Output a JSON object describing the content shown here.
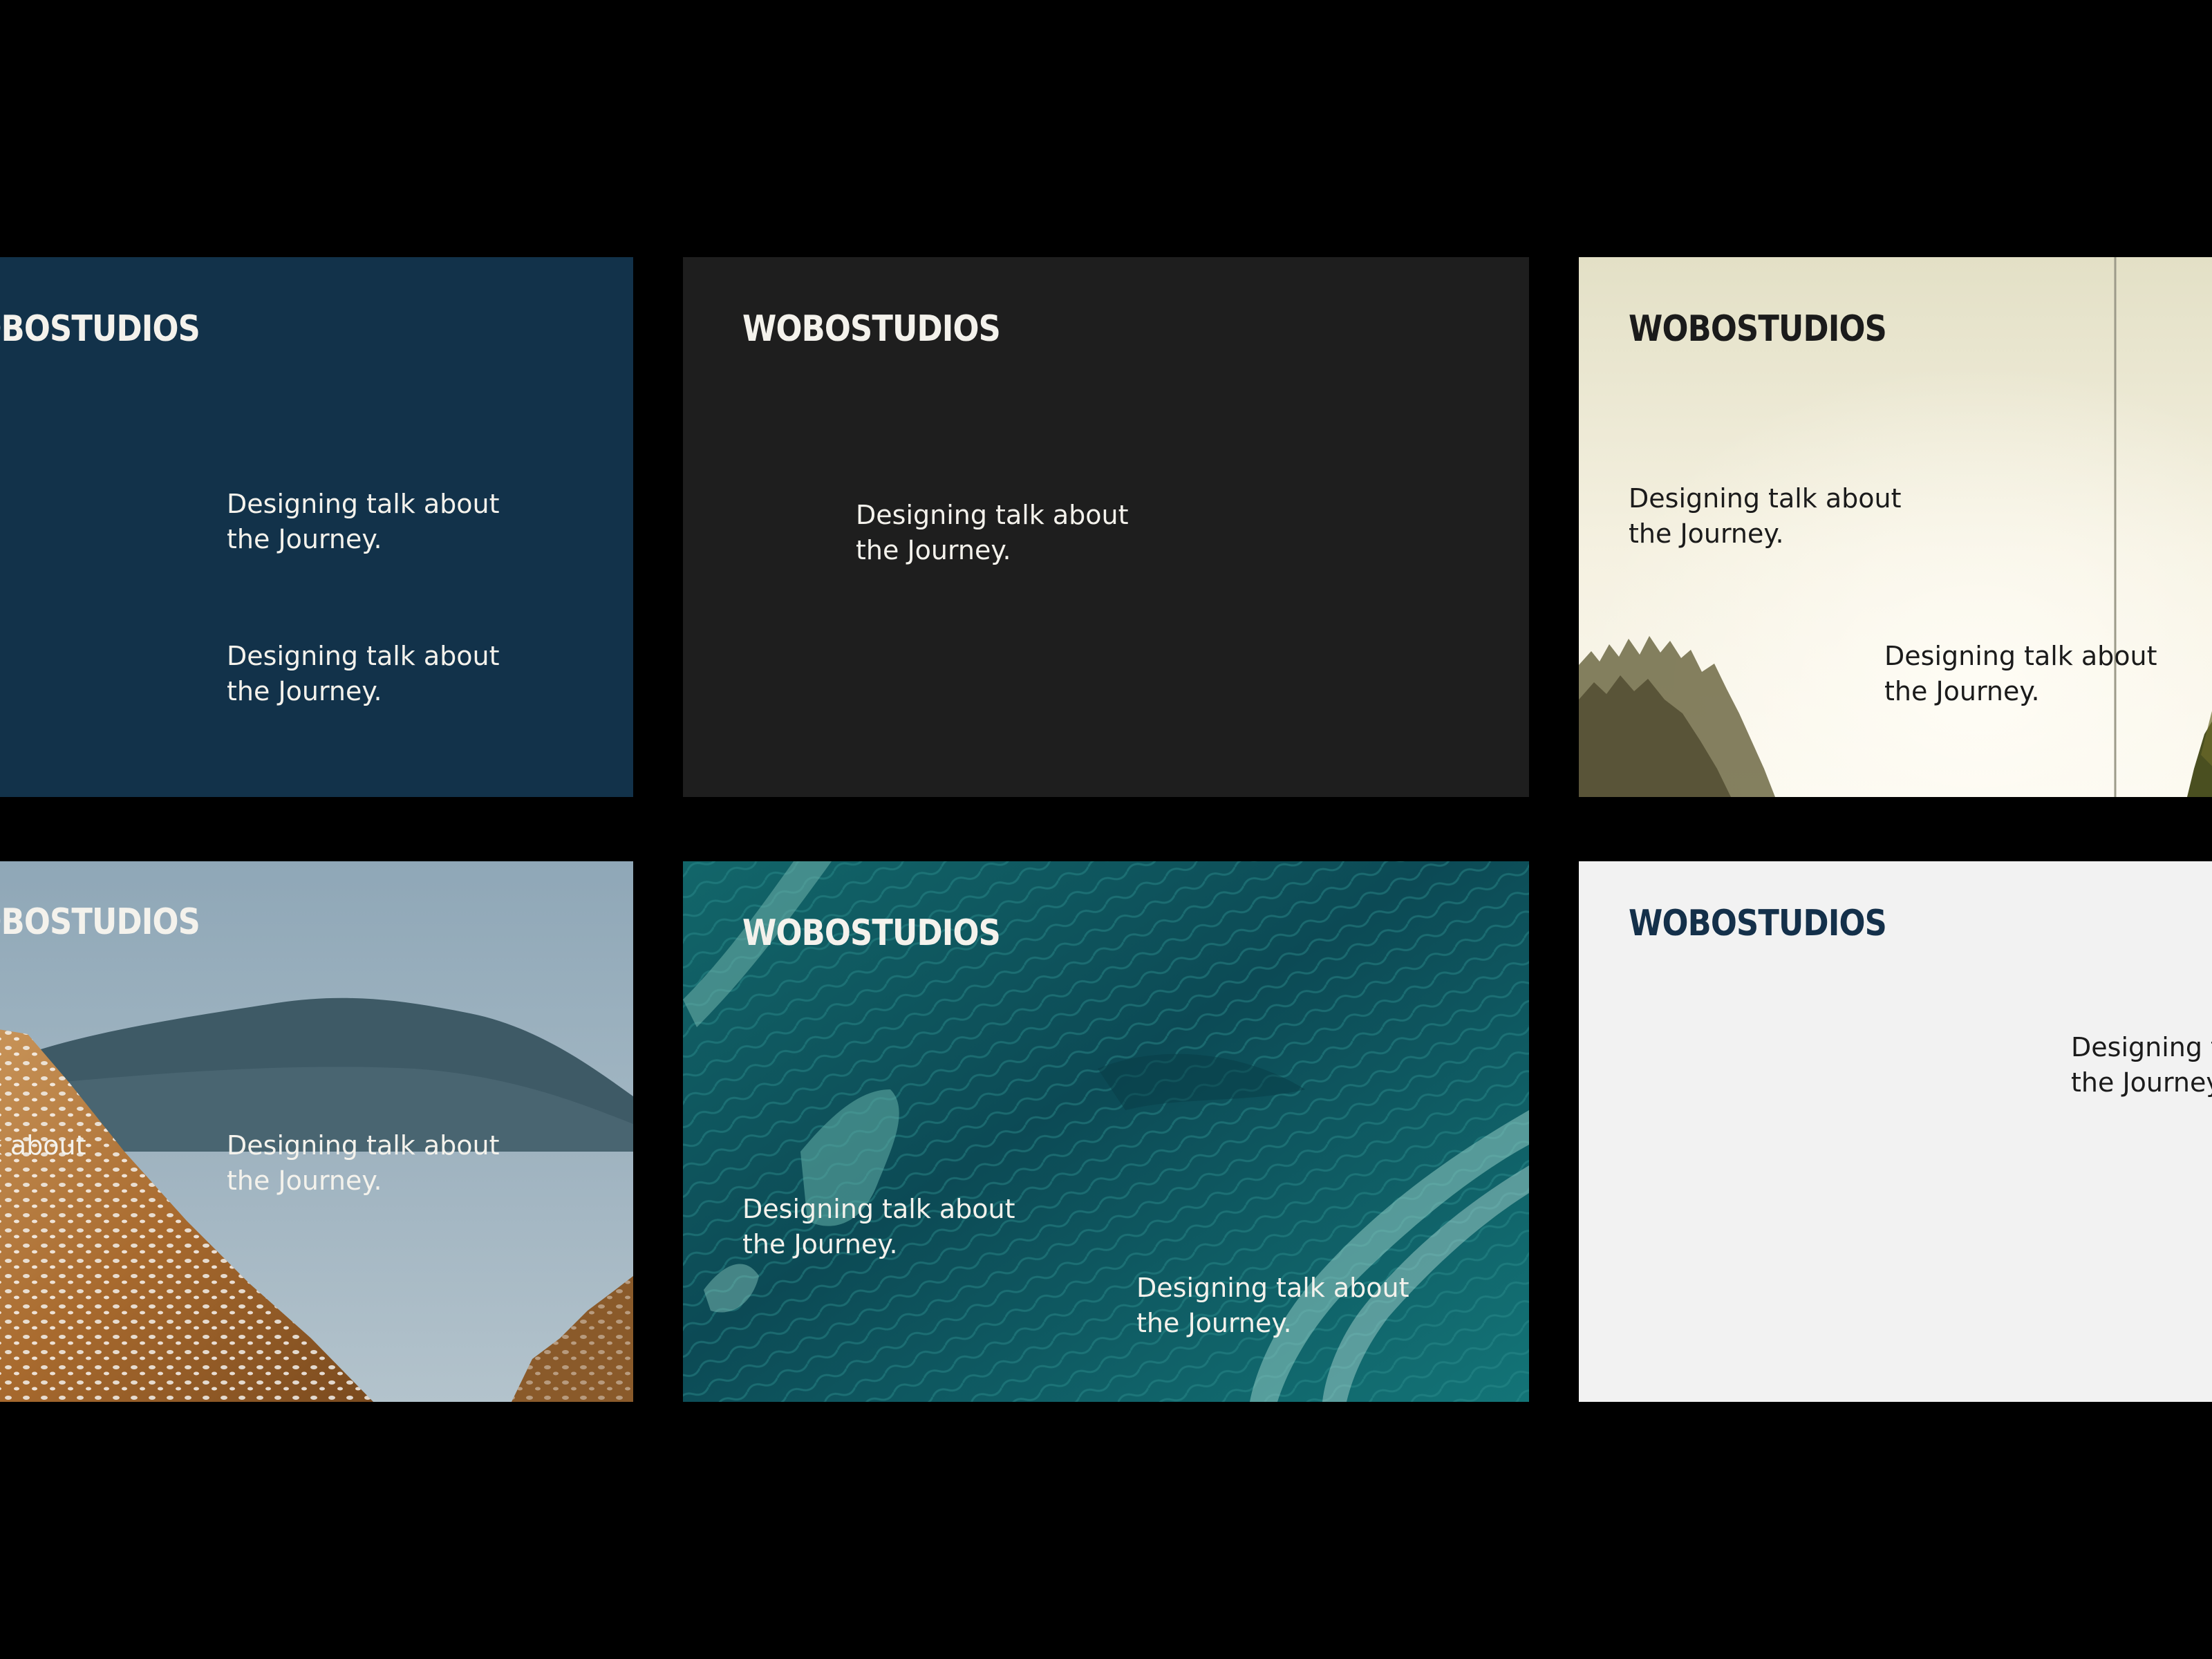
{
  "brand_name": "WOBOSTUDIOS",
  "tagline": {
    "line1": "Designing talk about",
    "line2": "the Journey."
  },
  "colors": {
    "background": "#000000",
    "navy": "#12324a",
    "charcoal": "#1e1e1e",
    "cream": "#f2efe2",
    "teal": "#0f4d52",
    "light_gray": "#f2f2f2"
  },
  "cards": [
    {
      "name": "navy-card",
      "background": "solid navy"
    },
    {
      "name": "charcoal-card",
      "background": "solid charcoal"
    },
    {
      "name": "forest-card",
      "background": "misty forest photo"
    },
    {
      "name": "mountain-card",
      "background": "snowy mountain and lake photo"
    },
    {
      "name": "ocean-card",
      "background": "aerial ocean waves photo"
    },
    {
      "name": "gray-card",
      "background": "solid light gray"
    }
  ]
}
